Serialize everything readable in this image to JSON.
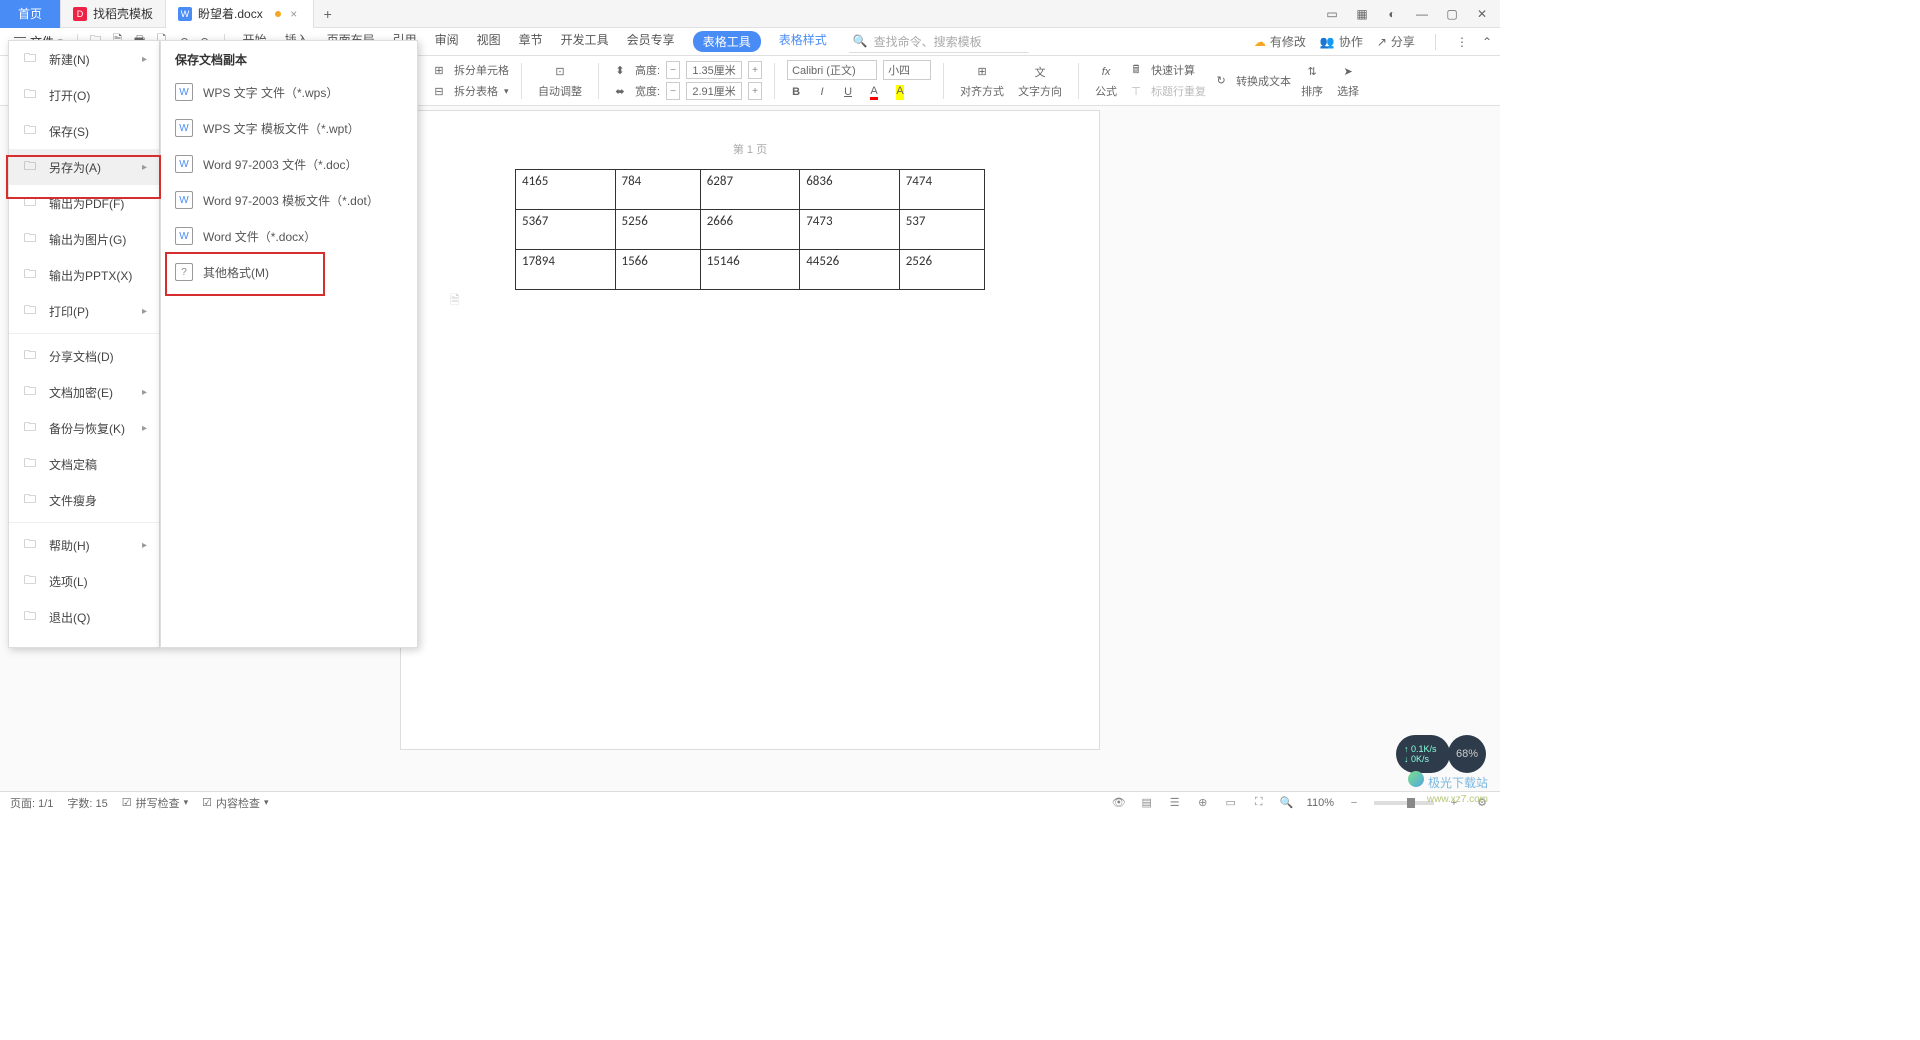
{
  "tabs": {
    "home": "首页",
    "template": "找稻壳模板",
    "doc": "盼望着.docx"
  },
  "file_label": "文件",
  "menus": [
    "开始",
    "插入",
    "页面布局",
    "引用",
    "审阅",
    "视图",
    "章节",
    "开发工具",
    "会员专享"
  ],
  "menu_pill": "表格工具",
  "menu_link": "表格样式",
  "search_placeholder": "查找命令、搜索模板",
  "top_right": {
    "changes": "有修改",
    "collab": "协作",
    "share": "分享"
  },
  "ribbon": {
    "split_cell": "拆分单元格",
    "split_table": "拆分表格",
    "auto_adjust": "自动调整",
    "height_lbl": "高度:",
    "width_lbl": "宽度:",
    "height_val": "1.35厘米",
    "width_val": "2.91厘米",
    "font_name": "Calibri (正文)",
    "font_size": "小四",
    "align": "对齐方式",
    "text_dir": "文字方向",
    "formula": "公式",
    "quick_calc": "快速计算",
    "header_repeat": "标题行重复",
    "to_text": "转换成文本",
    "sort": "排序",
    "select": "选择"
  },
  "filemenu": {
    "items": [
      {
        "label": "新建(N)",
        "arrow": true
      },
      {
        "label": "打开(O)"
      },
      {
        "label": "保存(S)"
      },
      {
        "label": "另存为(A)",
        "arrow": true,
        "highlight": true
      },
      {
        "label": "输出为PDF(F)"
      },
      {
        "label": "输出为图片(G)"
      },
      {
        "label": "输出为PPTX(X)"
      },
      {
        "label": "打印(P)",
        "arrow": true
      },
      {
        "sep": true
      },
      {
        "label": "分享文档(D)"
      },
      {
        "label": "文档加密(E)",
        "arrow": true
      },
      {
        "label": "备份与恢复(K)",
        "arrow": true
      },
      {
        "label": "文档定稿"
      },
      {
        "label": "文件瘦身"
      },
      {
        "sep": true
      },
      {
        "label": "帮助(H)",
        "arrow": true
      },
      {
        "label": "选项(L)"
      },
      {
        "label": "退出(Q)"
      }
    ]
  },
  "submenu": {
    "title": "保存文档副本",
    "items": [
      "WPS 文字 文件（*.wps）",
      "WPS 文字 模板文件（*.wpt）",
      "Word 97-2003 文件（*.doc）",
      "Word 97-2003 模板文件（*.dot）",
      "Word 文件（*.docx）",
      "其他格式(M)"
    ]
  },
  "page_number": "第 1 页",
  "table": [
    [
      "4165",
      "784",
      "6287",
      "6836",
      "7474"
    ],
    [
      "5367",
      "5256",
      "2666",
      "7473",
      "537"
    ],
    [
      "17894",
      "1566",
      "15146",
      "44526",
      "2526"
    ]
  ],
  "status": {
    "page": "页面: 1/1",
    "words": "字数: 15",
    "spell": "拼写检查",
    "content": "内容检查",
    "zoom": "110%"
  },
  "speed": {
    "up": "0.1K/s",
    "down": "0K/s",
    "pct": "68%"
  },
  "watermark": "极光下载站",
  "watermark2": "www.xz7.com"
}
